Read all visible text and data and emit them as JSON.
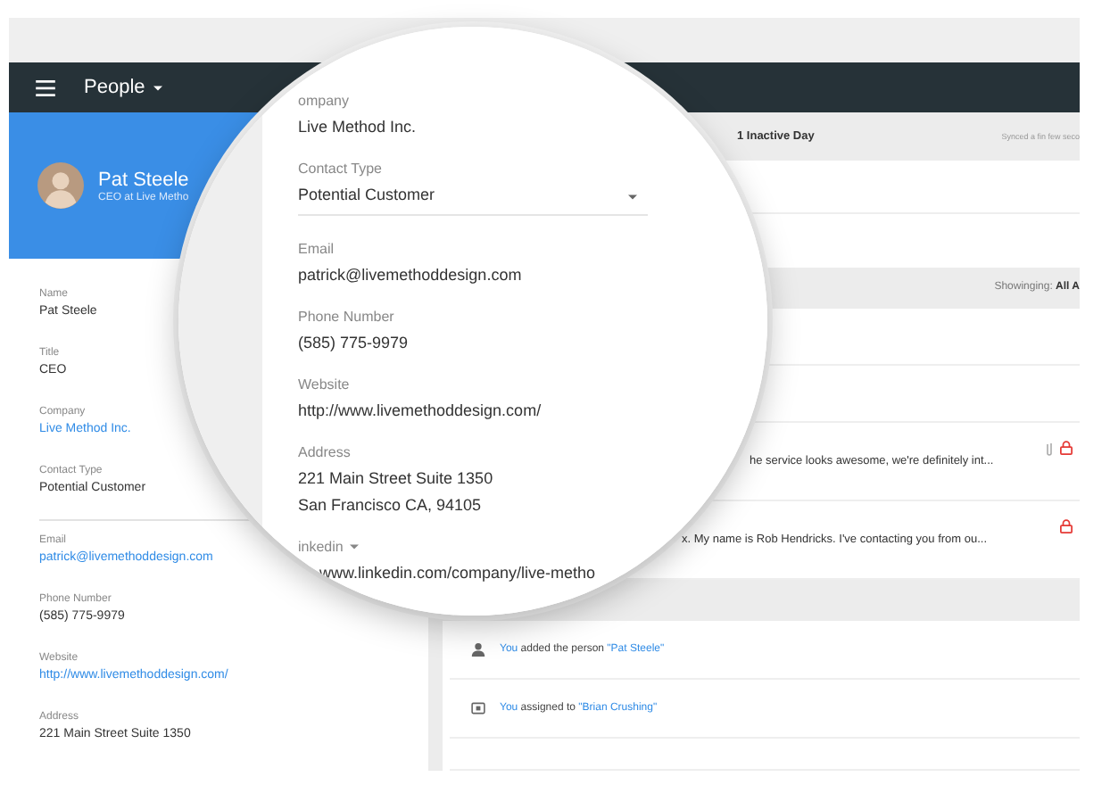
{
  "top_bar": {
    "title": "People"
  },
  "profile": {
    "name": "Pat Steele",
    "subtitle": "CEO at Live Metho"
  },
  "details": [
    {
      "label": "Name",
      "value": "Pat Steele",
      "kind": "text"
    },
    {
      "label": "Title",
      "value": "CEO",
      "kind": "text"
    },
    {
      "label": "Company",
      "value": "Live Method Inc.",
      "kind": "link"
    },
    {
      "label": "Contact Type",
      "value": "Potential Customer",
      "kind": "select"
    },
    {
      "label": "Email",
      "value": "patrick@livemethoddesign.com",
      "kind": "link"
    },
    {
      "label": "Phone Number",
      "value": "(585) 775-9979",
      "kind": "text"
    },
    {
      "label": "Website",
      "value": "http://www.livemethoddesign.com/",
      "kind": "link"
    },
    {
      "label": "Address",
      "value": "221 Main Street Suite 1350",
      "kind": "text"
    }
  ],
  "status_header": {
    "inactive": "1 Inactive Day",
    "synced": "Synced a fin few seco"
  },
  "filter": {
    "label": "Showinging:",
    "value": "All A"
  },
  "messages": [
    {
      "preview": "he service looks awesome, we're definitely int...",
      "attachment": true
    },
    {
      "preview": "x. My name is Rob Hendricks. I've contacting you from ou...",
      "attachment": false
    }
  ],
  "activity": [
    {
      "kind": "person",
      "actor": "You",
      "action": "added the person",
      "object": "\"Pat Steele\""
    },
    {
      "kind": "assign",
      "actor": "You",
      "action": "assigned to",
      "object": "\"Brian Crushing\""
    }
  ],
  "magnifier": {
    "fields": [
      {
        "label": "ompany",
        "lines": [
          "Live Method Inc."
        ],
        "kind": "link"
      },
      {
        "label": "Contact Type",
        "lines": [
          "Potential Customer"
        ],
        "kind": "select"
      },
      {
        "label": "Email",
        "lines": [
          "patrick@livemethoddesign.com"
        ],
        "kind": "link"
      },
      {
        "label": "Phone Number",
        "lines": [
          "(585) 775-9979"
        ],
        "kind": "text"
      },
      {
        "label": "Website",
        "lines": [
          "http://www.livemethoddesign.com/"
        ],
        "kind": "link"
      },
      {
        "label": "Address",
        "lines": [
          "221 Main Street Suite 1350",
          "San Francisco CA, 94105"
        ],
        "kind": "text"
      },
      {
        "label": "inkedin",
        "lines": [
          "www.linkedin.com/company/live-metho"
        ],
        "kind": "dropdown-link"
      }
    ]
  }
}
